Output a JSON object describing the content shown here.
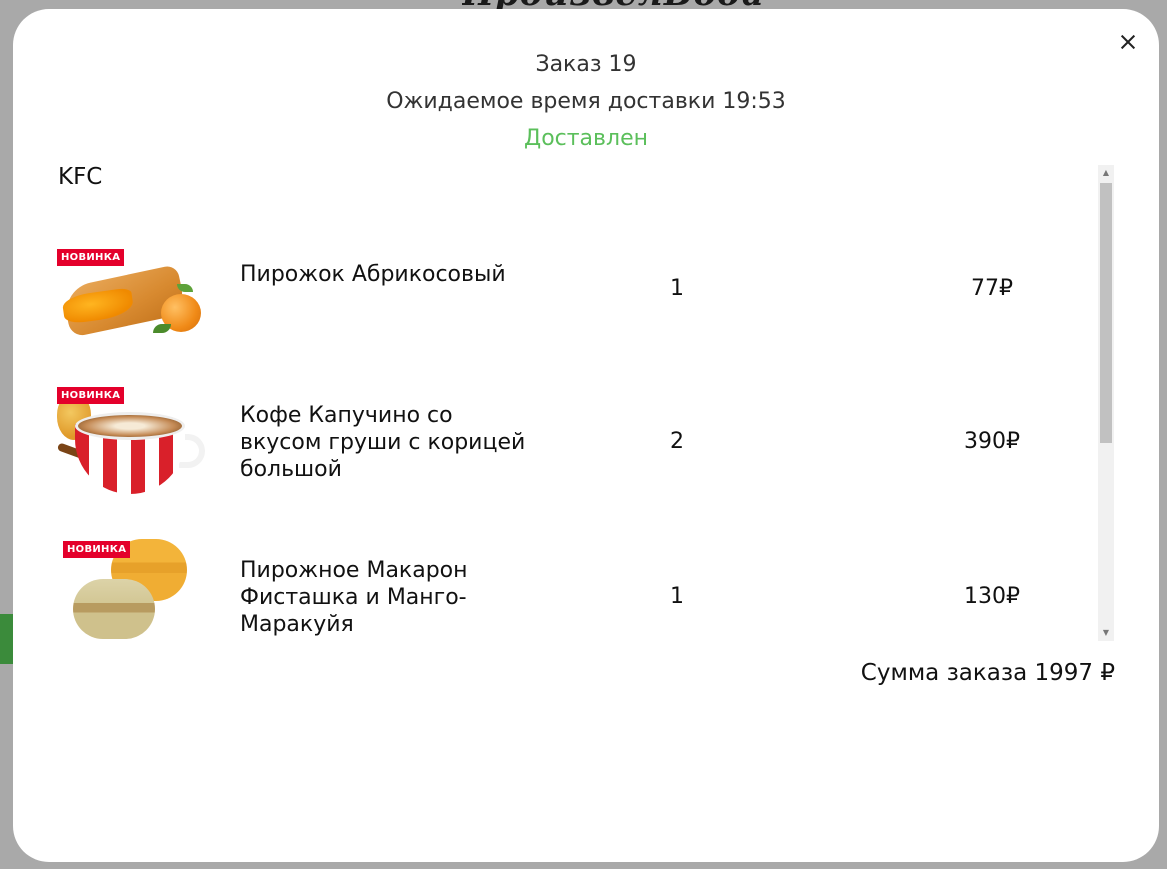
{
  "order": {
    "title": "Заказ 19",
    "delivery_time": "Ожидаемое время доставки 19:53",
    "status": "Доставлен",
    "status_color": "#5bbf5b",
    "restaurant": "KFC",
    "total": "Сумма заказа 1997 ₽"
  },
  "items": [
    {
      "name": "Пирожок Абрикосовый",
      "quantity": "1",
      "price": "77₽",
      "badge": "НОВИНКА",
      "image_icon": "apricot-pie-image"
    },
    {
      "name": "Кофе Капучино со вкусом груши с корицей большой",
      "quantity": "2",
      "price": "390₽",
      "badge": "НОВИНКА",
      "image_icon": "cappuccino-cup-image"
    },
    {
      "name": "Пирожное Макарон Фисташка и Манго-Маракуйя",
      "quantity": "1",
      "price": "130₽",
      "badge": "НОВИНКА",
      "image_icon": "macaron-image"
    }
  ],
  "close_icon": "close-icon",
  "background_logo": "ПроизвелВода",
  "colors": {
    "accent_green": "#5bbf5b",
    "badge_red": "#e4002b",
    "overlay": "#a9a9a9"
  }
}
